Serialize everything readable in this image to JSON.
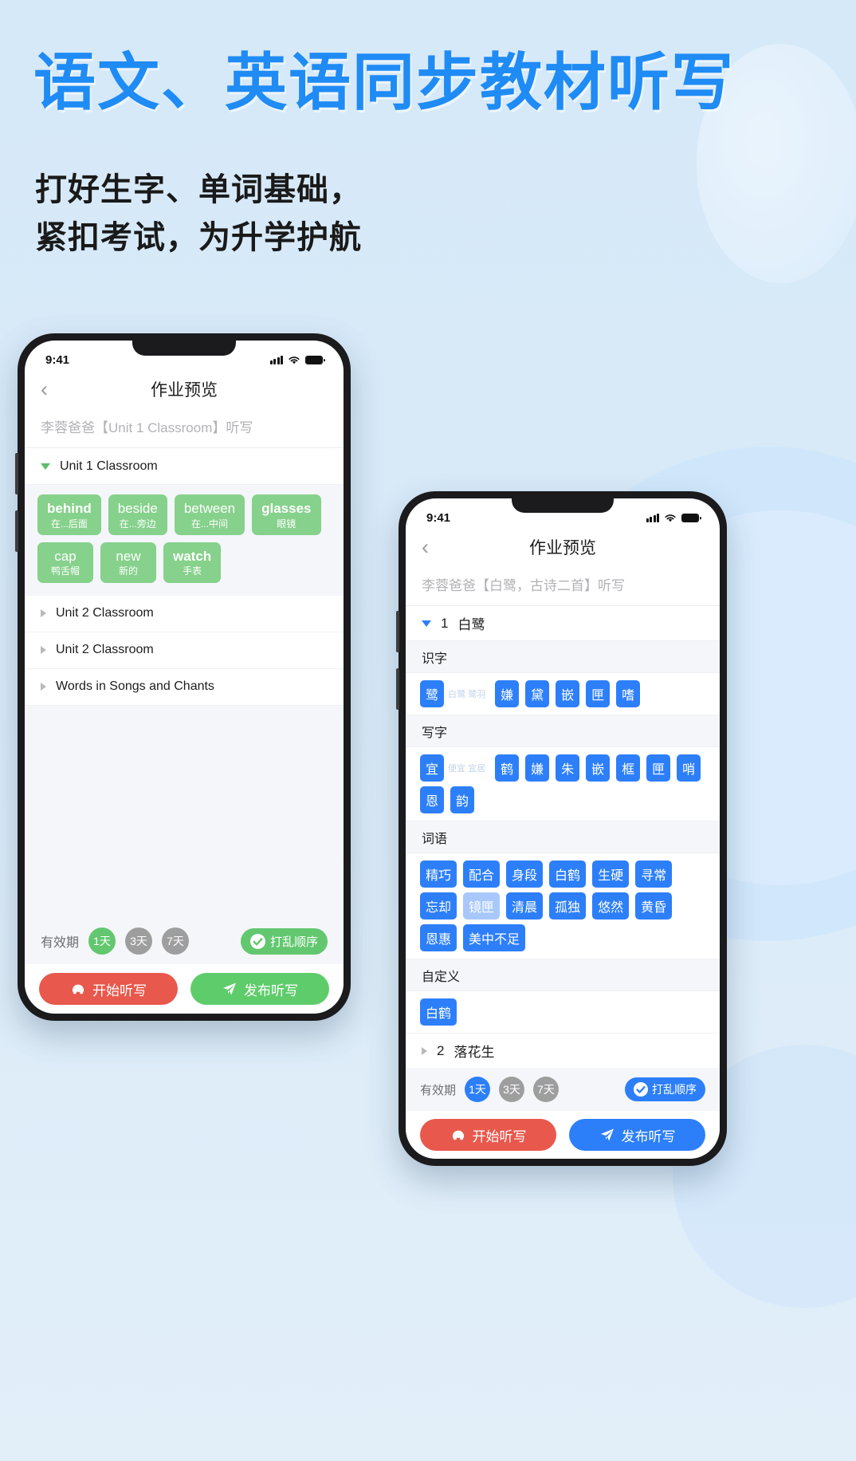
{
  "poster": {
    "headline": "语文、英语同步教材听写",
    "subhead_line1": "打好生字、单词基础，",
    "subhead_line2": "紧扣考试，为升学护航"
  },
  "phone_left": {
    "status": {
      "time": "9:41"
    },
    "nav": {
      "back_icon": "chevron-left-icon",
      "title": "作业预览"
    },
    "subtitle": "李蓉爸爸【Unit 1 Classroom】听写",
    "units": [
      {
        "label": "Unit 1 Classroom",
        "expanded": true
      },
      {
        "label": "Unit 2 Classroom",
        "expanded": false
      },
      {
        "label": "Unit 2 Classroom",
        "expanded": false
      },
      {
        "label": "Words in Songs and Chants",
        "expanded": false
      }
    ],
    "words": [
      {
        "word": "behind",
        "cn": "在...后面",
        "bold": true
      },
      {
        "word": "beside",
        "cn": "在...旁边",
        "bold": false
      },
      {
        "word": "between",
        "cn": "在...中间",
        "bold": false
      },
      {
        "word": "glasses",
        "cn": "眼镜",
        "bold": true
      },
      {
        "word": "cap",
        "cn": "鸭舌帽",
        "bold": false
      },
      {
        "word": "new",
        "cn": "新的",
        "bold": false
      },
      {
        "word": "watch",
        "cn": "手表",
        "bold": true
      }
    ],
    "validity": {
      "label": "有效期",
      "options": [
        {
          "label": "1天",
          "selected": true
        },
        {
          "label": "3天",
          "selected": false
        },
        {
          "label": "7天",
          "selected": false
        }
      ],
      "shuffle_label": "打乱顺序",
      "shuffle_icon": "check-circle-icon"
    },
    "actions": [
      {
        "label": "开始听写",
        "icon": "headphones-icon",
        "style": "red"
      },
      {
        "label": "发布听写",
        "icon": "paper-plane-icon",
        "style": "green"
      }
    ],
    "accent": "#62c76f"
  },
  "phone_right": {
    "status": {
      "time": "9:41"
    },
    "nav": {
      "back_icon": "chevron-left-icon",
      "title": "作业预览"
    },
    "subtitle": "李蓉爸爸【白鹭，古诗二首】听写",
    "lesson_expanded": {
      "number": "1",
      "title": "白鹭",
      "expanded": true
    },
    "lesson_collapsed": {
      "number": "2",
      "title": "落花生",
      "expanded": false
    },
    "sections": [
      {
        "title": "识字",
        "rows": [
          [
            {
              "text": "鹭",
              "hint": "白鹭 鹭羽",
              "pale": false
            },
            {
              "text": "嫌",
              "hint": "",
              "pale": false
            },
            {
              "text": "黛",
              "hint": "",
              "pale": false
            },
            {
              "text": "嵌",
              "hint": "",
              "pale": false
            },
            {
              "text": "匣",
              "hint": "",
              "pale": false
            },
            {
              "text": "嗜",
              "hint": "",
              "pale": false
            }
          ]
        ]
      },
      {
        "title": "写字",
        "rows": [
          [
            {
              "text": "宜",
              "hint": "便宜 宜居",
              "pale": false
            },
            {
              "text": "鹤",
              "hint": "",
              "pale": false
            },
            {
              "text": "嫌",
              "hint": "",
              "pale": false
            },
            {
              "text": "朱",
              "hint": "",
              "pale": false
            },
            {
              "text": "嵌",
              "hint": "",
              "pale": false
            },
            {
              "text": "框",
              "hint": "",
              "pale": false
            },
            {
              "text": "匣",
              "hint": "",
              "pale": false
            },
            {
              "text": "哨",
              "hint": "",
              "pale": false
            }
          ],
          [
            {
              "text": "恩",
              "hint": "",
              "pale": false
            },
            {
              "text": "韵",
              "hint": "",
              "pale": false
            }
          ]
        ]
      },
      {
        "title": "词语",
        "rows": [
          [
            {
              "text": "精巧",
              "hint": "",
              "pale": false
            },
            {
              "text": "配合",
              "hint": "",
              "pale": false
            },
            {
              "text": "身段",
              "hint": "",
              "pale": false
            },
            {
              "text": "白鹤",
              "hint": "",
              "pale": false
            },
            {
              "text": "生硬",
              "hint": "",
              "pale": false
            },
            {
              "text": "寻常",
              "hint": "",
              "pale": false
            }
          ],
          [
            {
              "text": "忘却",
              "hint": "",
              "pale": false
            },
            {
              "text": "镜匣",
              "hint": "",
              "pale": true
            },
            {
              "text": "清晨",
              "hint": "",
              "pale": false
            },
            {
              "text": "孤独",
              "hint": "",
              "pale": false
            },
            {
              "text": "悠然",
              "hint": "",
              "pale": false
            },
            {
              "text": "黄昏",
              "hint": "",
              "pale": false
            }
          ],
          [
            {
              "text": "恩惠",
              "hint": "",
              "pale": false
            },
            {
              "text": "美中不足",
              "hint": "",
              "pale": false
            }
          ]
        ]
      },
      {
        "title": "自定义",
        "rows": [
          [
            {
              "text": "白鹤",
              "hint": "",
              "pale": false
            }
          ]
        ]
      }
    ],
    "validity": {
      "label": "有效期",
      "options": [
        {
          "label": "1天",
          "selected": true
        },
        {
          "label": "3天",
          "selected": false
        },
        {
          "label": "7天",
          "selected": false
        }
      ],
      "shuffle_label": "打乱顺序",
      "shuffle_icon": "check-circle-icon"
    },
    "actions": [
      {
        "label": "开始听写",
        "icon": "headphones-icon",
        "style": "red"
      },
      {
        "label": "发布听写",
        "icon": "paper-plane-icon",
        "style": "blue"
      }
    ],
    "accent": "#2d7ff9"
  },
  "colors": {
    "brand_blue": "#1f8bf5",
    "chip_blue": "#2d7ff9",
    "chip_green": "#86d18b",
    "action_red": "#e8584c",
    "action_green": "#5fcc6c",
    "background": "#d9eaf8"
  }
}
